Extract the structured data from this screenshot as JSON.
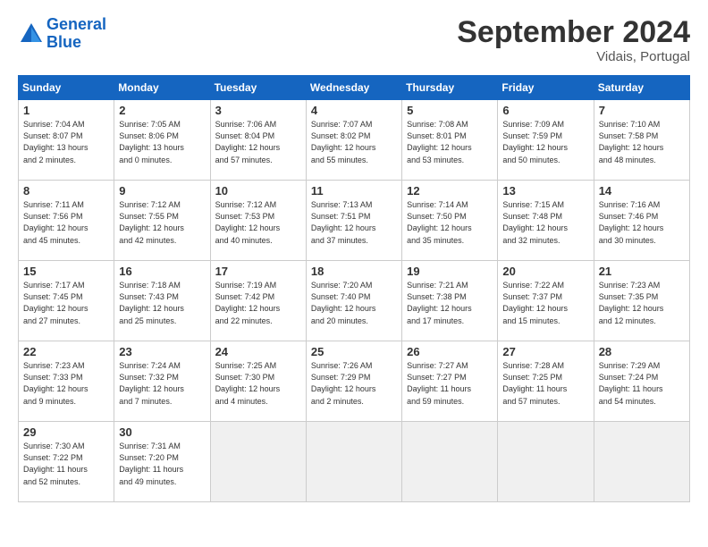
{
  "header": {
    "logo_line1": "General",
    "logo_line2": "Blue",
    "month_title": "September 2024",
    "location": "Vidais, Portugal"
  },
  "weekdays": [
    "Sunday",
    "Monday",
    "Tuesday",
    "Wednesday",
    "Thursday",
    "Friday",
    "Saturday"
  ],
  "weeks": [
    [
      {
        "day": 1,
        "info": "Sunrise: 7:04 AM\nSunset: 8:07 PM\nDaylight: 13 hours\nand 2 minutes."
      },
      {
        "day": 2,
        "info": "Sunrise: 7:05 AM\nSunset: 8:06 PM\nDaylight: 13 hours\nand 0 minutes."
      },
      {
        "day": 3,
        "info": "Sunrise: 7:06 AM\nSunset: 8:04 PM\nDaylight: 12 hours\nand 57 minutes."
      },
      {
        "day": 4,
        "info": "Sunrise: 7:07 AM\nSunset: 8:02 PM\nDaylight: 12 hours\nand 55 minutes."
      },
      {
        "day": 5,
        "info": "Sunrise: 7:08 AM\nSunset: 8:01 PM\nDaylight: 12 hours\nand 53 minutes."
      },
      {
        "day": 6,
        "info": "Sunrise: 7:09 AM\nSunset: 7:59 PM\nDaylight: 12 hours\nand 50 minutes."
      },
      {
        "day": 7,
        "info": "Sunrise: 7:10 AM\nSunset: 7:58 PM\nDaylight: 12 hours\nand 48 minutes."
      }
    ],
    [
      {
        "day": 8,
        "info": "Sunrise: 7:11 AM\nSunset: 7:56 PM\nDaylight: 12 hours\nand 45 minutes."
      },
      {
        "day": 9,
        "info": "Sunrise: 7:12 AM\nSunset: 7:55 PM\nDaylight: 12 hours\nand 42 minutes."
      },
      {
        "day": 10,
        "info": "Sunrise: 7:12 AM\nSunset: 7:53 PM\nDaylight: 12 hours\nand 40 minutes."
      },
      {
        "day": 11,
        "info": "Sunrise: 7:13 AM\nSunset: 7:51 PM\nDaylight: 12 hours\nand 37 minutes."
      },
      {
        "day": 12,
        "info": "Sunrise: 7:14 AM\nSunset: 7:50 PM\nDaylight: 12 hours\nand 35 minutes."
      },
      {
        "day": 13,
        "info": "Sunrise: 7:15 AM\nSunset: 7:48 PM\nDaylight: 12 hours\nand 32 minutes."
      },
      {
        "day": 14,
        "info": "Sunrise: 7:16 AM\nSunset: 7:46 PM\nDaylight: 12 hours\nand 30 minutes."
      }
    ],
    [
      {
        "day": 15,
        "info": "Sunrise: 7:17 AM\nSunset: 7:45 PM\nDaylight: 12 hours\nand 27 minutes."
      },
      {
        "day": 16,
        "info": "Sunrise: 7:18 AM\nSunset: 7:43 PM\nDaylight: 12 hours\nand 25 minutes."
      },
      {
        "day": 17,
        "info": "Sunrise: 7:19 AM\nSunset: 7:42 PM\nDaylight: 12 hours\nand 22 minutes."
      },
      {
        "day": 18,
        "info": "Sunrise: 7:20 AM\nSunset: 7:40 PM\nDaylight: 12 hours\nand 20 minutes."
      },
      {
        "day": 19,
        "info": "Sunrise: 7:21 AM\nSunset: 7:38 PM\nDaylight: 12 hours\nand 17 minutes."
      },
      {
        "day": 20,
        "info": "Sunrise: 7:22 AM\nSunset: 7:37 PM\nDaylight: 12 hours\nand 15 minutes."
      },
      {
        "day": 21,
        "info": "Sunrise: 7:23 AM\nSunset: 7:35 PM\nDaylight: 12 hours\nand 12 minutes."
      }
    ],
    [
      {
        "day": 22,
        "info": "Sunrise: 7:23 AM\nSunset: 7:33 PM\nDaylight: 12 hours\nand 9 minutes."
      },
      {
        "day": 23,
        "info": "Sunrise: 7:24 AM\nSunset: 7:32 PM\nDaylight: 12 hours\nand 7 minutes."
      },
      {
        "day": 24,
        "info": "Sunrise: 7:25 AM\nSunset: 7:30 PM\nDaylight: 12 hours\nand 4 minutes."
      },
      {
        "day": 25,
        "info": "Sunrise: 7:26 AM\nSunset: 7:29 PM\nDaylight: 12 hours\nand 2 minutes."
      },
      {
        "day": 26,
        "info": "Sunrise: 7:27 AM\nSunset: 7:27 PM\nDaylight: 11 hours\nand 59 minutes."
      },
      {
        "day": 27,
        "info": "Sunrise: 7:28 AM\nSunset: 7:25 PM\nDaylight: 11 hours\nand 57 minutes."
      },
      {
        "day": 28,
        "info": "Sunrise: 7:29 AM\nSunset: 7:24 PM\nDaylight: 11 hours\nand 54 minutes."
      }
    ],
    [
      {
        "day": 29,
        "info": "Sunrise: 7:30 AM\nSunset: 7:22 PM\nDaylight: 11 hours\nand 52 minutes."
      },
      {
        "day": 30,
        "info": "Sunrise: 7:31 AM\nSunset: 7:20 PM\nDaylight: 11 hours\nand 49 minutes."
      },
      null,
      null,
      null,
      null,
      null
    ]
  ]
}
